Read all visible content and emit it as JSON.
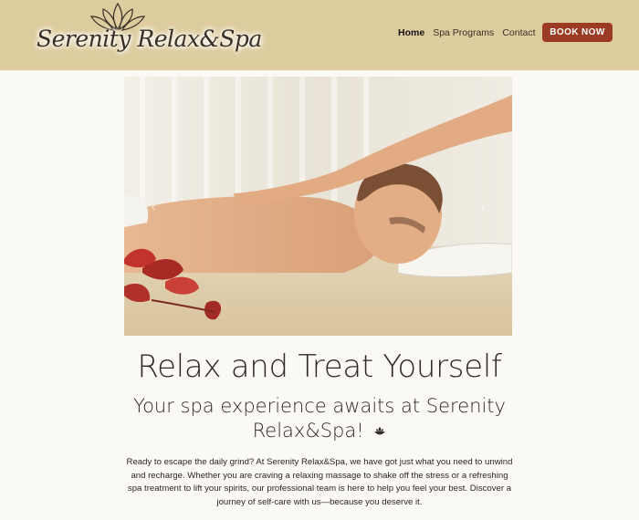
{
  "brand": {
    "name": "Serenity Relax&Spa"
  },
  "nav": {
    "items": [
      {
        "label": "Home"
      },
      {
        "label": "Spa Programs"
      },
      {
        "label": "Contact"
      }
    ],
    "cta_label": "BOOK NOW"
  },
  "hero": {
    "prev_arrow": "‹",
    "next_arrow": "›"
  },
  "main": {
    "title": "Relax and Treat Yourself",
    "subtitle": "Your spa experience awaits at Serenity Relax&Spa!",
    "body": "Ready to escape the daily grind? At Serenity Relax&Spa, we have got just what you need to unwind and recharge. Whether you are craving a relaxing massage to shake off the stress or a refreshing spa treatment to lift your spirits, our professional team is here to help you feel your best. Discover a journey of self-care with us—because you deserve it."
  },
  "colors": {
    "header_bg": "#ddcc9e",
    "page_bg": "#fbf9f6",
    "accent": "#9b3b24"
  }
}
